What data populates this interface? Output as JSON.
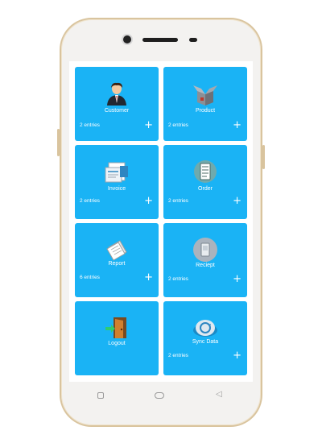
{
  "tiles": [
    {
      "label": "Customer",
      "entries": "2 entries",
      "plus": "+",
      "icon": "customer-icon"
    },
    {
      "label": "Product",
      "entries": "2 entries",
      "plus": "+",
      "icon": "product-box-icon"
    },
    {
      "label": "Invoice",
      "entries": "2 entries",
      "plus": "+",
      "icon": "invoice-icon"
    },
    {
      "label": "Order",
      "entries": "2 entries",
      "plus": "+",
      "icon": "order-list-icon"
    },
    {
      "label": "Report",
      "entries": "6 entries",
      "plus": "+",
      "icon": "report-icon"
    },
    {
      "label": "Reciept",
      "entries": "2 entries",
      "plus": "+",
      "icon": "receipt-icon"
    },
    {
      "label": "Logout",
      "icon": "logout-door-icon"
    },
    {
      "label": "Sync Data",
      "entries": "2 entries",
      "plus": "+",
      "icon": "sync-icon"
    }
  ],
  "navbar": {
    "back_glyph": "◁"
  },
  "colors": {
    "tile": "#1ab3f5",
    "phone_frame": "#d9c49e"
  }
}
